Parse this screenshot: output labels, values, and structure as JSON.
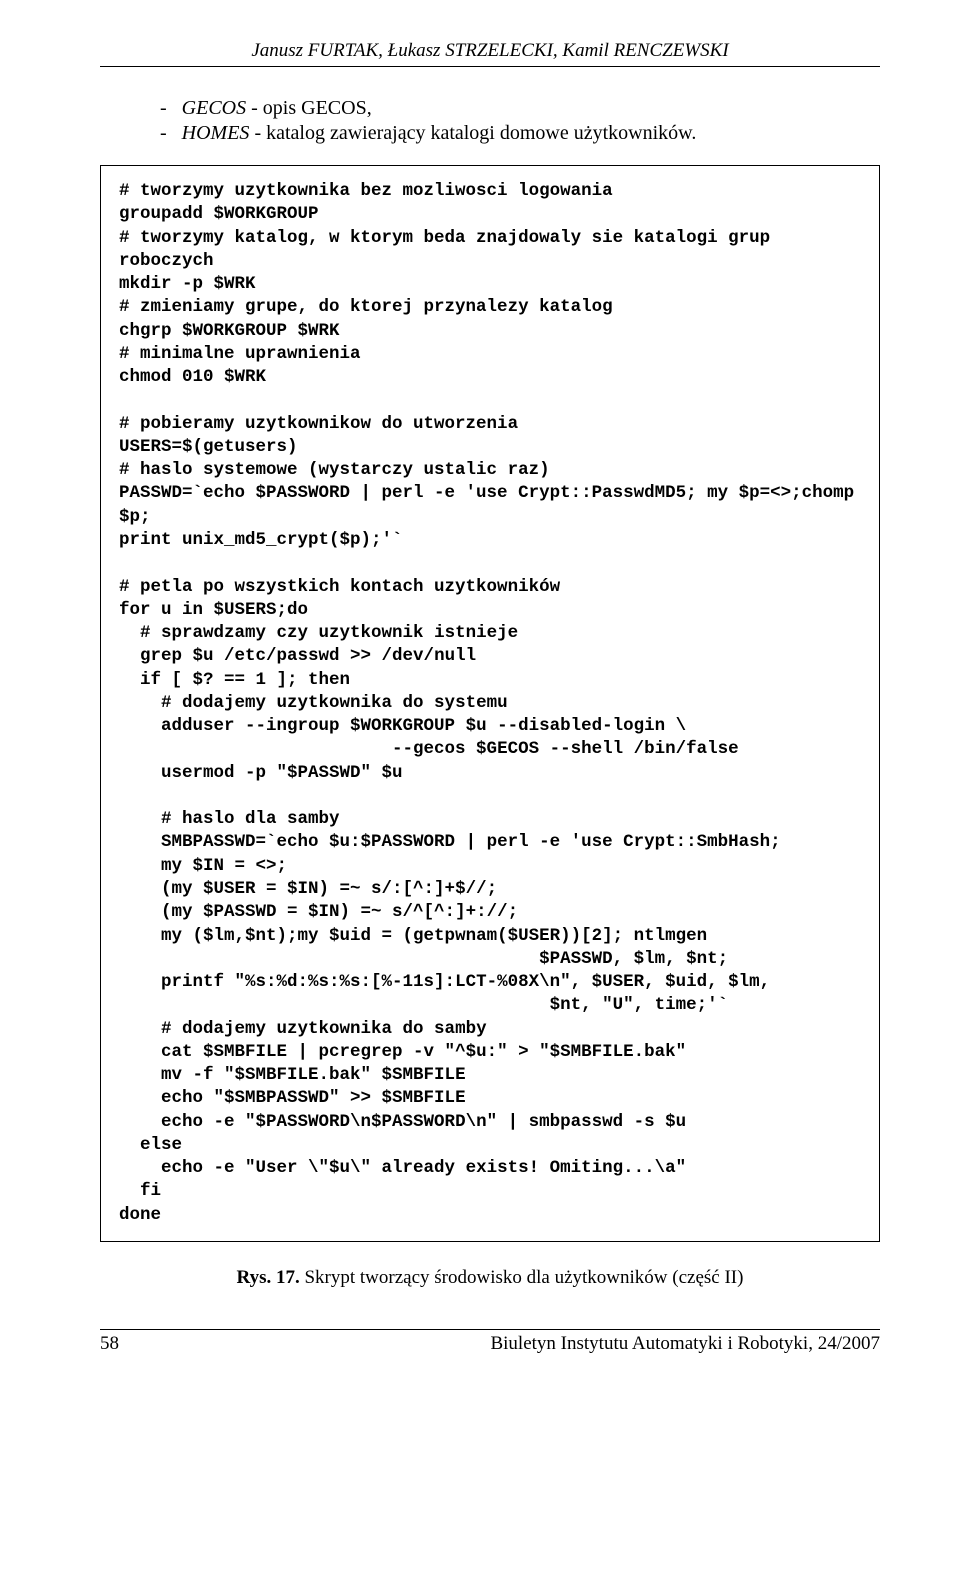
{
  "header": "Janusz FURTAK, Łukasz STRZELECKI, Kamil RENCZEWSKI",
  "list": {
    "item1_label": "GECOS",
    "item1_desc": " - opis GECOS,",
    "item2_label": "HOMES",
    "item2_desc": " - katalog zawierający katalogi domowe użytkowników."
  },
  "code": "# tworzymy uzytkownika bez mozliwosci logowania\ngroupadd $WORKGROUP\n# tworzymy katalog, w ktorym beda znajdowaly sie katalogi grup roboczych\nmkdir -p $WRK\n# zmieniamy grupe, do ktorej przynalezy katalog\nchgrp $WORKGROUP $WRK\n# minimalne uprawnienia\nchmod 010 $WRK\n\n# pobieramy uzytkownikow do utworzenia\nUSERS=$(getusers)\n# haslo systemowe (wystarczy ustalic raz)\nPASSWD=`echo $PASSWORD | perl -e 'use Crypt::PasswdMD5; my $p=<>;chomp $p;\nprint unix_md5_crypt($p);'`\n\n# petla po wszystkich kontach uzytkowników\nfor u in $USERS;do\n  # sprawdzamy czy uzytkownik istnieje\n  grep $u /etc/passwd >> /dev/null\n  if [ $? == 1 ]; then\n    # dodajemy uzytkownika do systemu\n    adduser --ingroup $WORKGROUP $u --disabled-login \\\n                          --gecos $GECOS --shell /bin/false\n    usermod -p \"$PASSWD\" $u\n\n    # haslo dla samby\n    SMBPASSWD=`echo $u:$PASSWORD | perl -e 'use Crypt::SmbHash;\n    my $IN = <>;\n    (my $USER = $IN) =~ s/:[^:]+$//;\n    (my $PASSWD = $IN) =~ s/^[^:]+://;\n    my ($lm,$nt);my $uid = (getpwnam($USER))[2]; ntlmgen\n                                        $PASSWD, $lm, $nt;\n    printf \"%s:%d:%s:%s:[%-11s]:LCT-%08X\\n\", $USER, $uid, $lm,\n                                         $nt, \"U\", time;'`\n    # dodajemy uzytkownika do samby\n    cat $SMBFILE | pcregrep -v \"^$u:\" > \"$SMBFILE.bak\"\n    mv -f \"$SMBFILE.bak\" $SMBFILE\n    echo \"$SMBPASSWD\" >> $SMBFILE\n    echo -e \"$PASSWORD\\n$PASSWORD\\n\" | smbpasswd -s $u\n  else\n    echo -e \"User \\\"$u\\\" already exists! Omiting...\\a\"\n  fi\ndone",
  "caption_label": "Rys. 17.",
  "caption_text": " Skrypt tworzący środowisko dla użytkowników (część II)",
  "footer_left": "58",
  "footer_right": "Biuletyn Instytutu Automatyki i Robotyki, 24/2007"
}
